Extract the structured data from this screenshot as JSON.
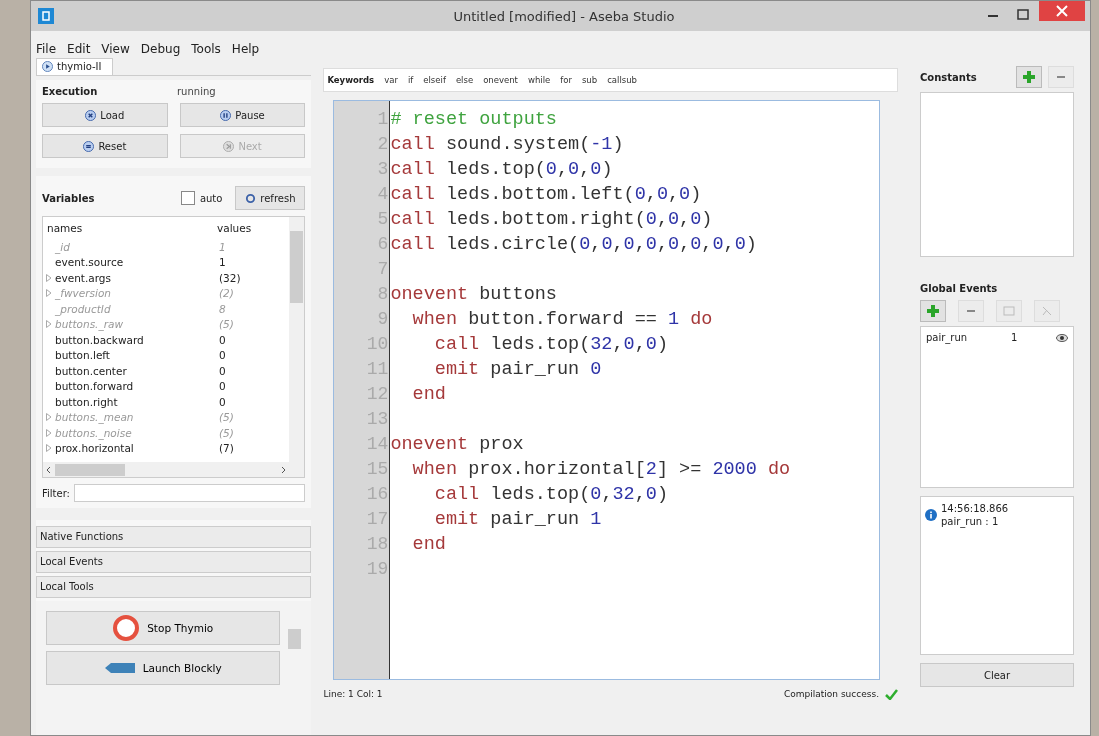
{
  "window": {
    "title": "Untitled [modified] - Aseba Studio"
  },
  "menu": [
    "File",
    "Edit",
    "View",
    "Debug",
    "Tools",
    "Help"
  ],
  "tabs": [
    {
      "label": "thymio-II",
      "selected": true
    }
  ],
  "execution": {
    "title": "Execution",
    "status": "running",
    "buttons": [
      {
        "label": "Load",
        "disabled": false
      },
      {
        "label": "Pause",
        "disabled": false
      },
      {
        "label": "Reset",
        "disabled": false
      },
      {
        "label": "Next",
        "disabled": true
      }
    ]
  },
  "variables": {
    "title": "Variables",
    "auto": {
      "label": "auto",
      "checked": false
    },
    "refresh": "refresh",
    "columns": [
      "names",
      "values"
    ],
    "filter_label": "Filter:",
    "rows": [
      {
        "name": "_id",
        "value": "1",
        "system": true,
        "expandable": false
      },
      {
        "name": "event.source",
        "value": "1",
        "system": false,
        "expandable": false
      },
      {
        "name": "event.args",
        "value": "(32)",
        "system": false,
        "expandable": true
      },
      {
        "name": "_fwversion",
        "value": "(2)",
        "system": true,
        "expandable": true
      },
      {
        "name": "_productId",
        "value": "8",
        "system": true,
        "expandable": false
      },
      {
        "name": "buttons._raw",
        "value": "(5)",
        "system": true,
        "expandable": true
      },
      {
        "name": "button.backward",
        "value": "0",
        "system": false,
        "expandable": false
      },
      {
        "name": "button.left",
        "value": "0",
        "system": false,
        "expandable": false
      },
      {
        "name": "button.center",
        "value": "0",
        "system": false,
        "expandable": false
      },
      {
        "name": "button.forward",
        "value": "0",
        "system": false,
        "expandable": false
      },
      {
        "name": "button.right",
        "value": "0",
        "system": false,
        "expandable": false
      },
      {
        "name": "buttons._mean",
        "value": "(5)",
        "system": true,
        "expandable": true
      },
      {
        "name": "buttons._noise",
        "value": "(5)",
        "system": true,
        "expandable": true
      },
      {
        "name": "prox.horizontal",
        "value": "(7)",
        "system": false,
        "expandable": true
      }
    ]
  },
  "toolbox": {
    "sections": [
      "Native Functions",
      "Local Events",
      "Local Tools"
    ],
    "tools": [
      "Stop Thymio",
      "Launch Blockly"
    ]
  },
  "keywords": {
    "title": "Keywords",
    "items": [
      "var",
      "if",
      "elseif",
      "else",
      "onevent",
      "while",
      "for",
      "sub",
      "callsub"
    ]
  },
  "code": [
    {
      "number": "1",
      "tokens": [
        {
          "kind": "comment",
          "text": "# reset outputs"
        }
      ]
    },
    {
      "number": "2",
      "tokens": [
        {
          "kind": "keyword",
          "text": "call"
        },
        {
          "kind": "plain",
          "text": " sound.system("
        },
        {
          "kind": "number",
          "text": "-1"
        },
        {
          "kind": "plain",
          "text": ")"
        }
      ]
    },
    {
      "number": "3",
      "tokens": [
        {
          "kind": "keyword",
          "text": "call"
        },
        {
          "kind": "plain",
          "text": " leds.top("
        },
        {
          "kind": "number",
          "text": "0"
        },
        {
          "kind": "plain",
          "text": ","
        },
        {
          "kind": "number",
          "text": "0"
        },
        {
          "kind": "plain",
          "text": ","
        },
        {
          "kind": "number",
          "text": "0"
        },
        {
          "kind": "plain",
          "text": ")"
        }
      ]
    },
    {
      "number": "4",
      "tokens": [
        {
          "kind": "keyword",
          "text": "call"
        },
        {
          "kind": "plain",
          "text": " leds.bottom.left("
        },
        {
          "kind": "number",
          "text": "0"
        },
        {
          "kind": "plain",
          "text": ","
        },
        {
          "kind": "number",
          "text": "0"
        },
        {
          "kind": "plain",
          "text": ","
        },
        {
          "kind": "number",
          "text": "0"
        },
        {
          "kind": "plain",
          "text": ")"
        }
      ]
    },
    {
      "number": "5",
      "tokens": [
        {
          "kind": "keyword",
          "text": "call"
        },
        {
          "kind": "plain",
          "text": " leds.bottom.right("
        },
        {
          "kind": "number",
          "text": "0"
        },
        {
          "kind": "plain",
          "text": ","
        },
        {
          "kind": "number",
          "text": "0"
        },
        {
          "kind": "plain",
          "text": ","
        },
        {
          "kind": "number",
          "text": "0"
        },
        {
          "kind": "plain",
          "text": ")"
        }
      ]
    },
    {
      "number": "6",
      "tokens": [
        {
          "kind": "keyword",
          "text": "call"
        },
        {
          "kind": "plain",
          "text": " leds.circle("
        },
        {
          "kind": "number",
          "text": "0"
        },
        {
          "kind": "plain",
          "text": ","
        },
        {
          "kind": "number",
          "text": "0"
        },
        {
          "kind": "plain",
          "text": ","
        },
        {
          "kind": "number",
          "text": "0"
        },
        {
          "kind": "plain",
          "text": ","
        },
        {
          "kind": "number",
          "text": "0"
        },
        {
          "kind": "plain",
          "text": ","
        },
        {
          "kind": "number",
          "text": "0"
        },
        {
          "kind": "plain",
          "text": ","
        },
        {
          "kind": "number",
          "text": "0"
        },
        {
          "kind": "plain",
          "text": ","
        },
        {
          "kind": "number",
          "text": "0"
        },
        {
          "kind": "plain",
          "text": ","
        },
        {
          "kind": "number",
          "text": "0"
        },
        {
          "kind": "plain",
          "text": ")"
        }
      ]
    },
    {
      "number": "7"
    },
    {
      "number": "8",
      "tokens": [
        {
          "kind": "keyword",
          "text": "onevent"
        },
        {
          "kind": "plain",
          "text": " buttons"
        }
      ]
    },
    {
      "number": "9",
      "tokens": [
        {
          "kind": "keyword",
          "text": "  when"
        },
        {
          "kind": "plain",
          "text": " button.forward == "
        },
        {
          "kind": "number",
          "text": "1"
        },
        {
          "kind": "keyword",
          "text": " do"
        }
      ]
    },
    {
      "number": "10",
      "tokens": [
        {
          "kind": "keyword",
          "text": "    call"
        },
        {
          "kind": "plain",
          "text": " leds.top("
        },
        {
          "kind": "number",
          "text": "32"
        },
        {
          "kind": "plain",
          "text": ","
        },
        {
          "kind": "number",
          "text": "0"
        },
        {
          "kind": "plain",
          "text": ","
        },
        {
          "kind": "number",
          "text": "0"
        },
        {
          "kind": "plain",
          "text": ")"
        }
      ]
    },
    {
      "number": "11",
      "tokens": [
        {
          "kind": "keyword",
          "text": "    emit"
        },
        {
          "kind": "plain",
          "text": " pair_run "
        },
        {
          "kind": "number",
          "text": "0"
        }
      ]
    },
    {
      "number": "12",
      "tokens": [
        {
          "kind": "keyword",
          "text": "  end"
        }
      ]
    },
    {
      "number": "13"
    },
    {
      "number": "14",
      "tokens": [
        {
          "kind": "keyword",
          "text": "onevent"
        },
        {
          "kind": "plain",
          "text": " prox"
        }
      ]
    },
    {
      "number": "15",
      "tokens": [
        {
          "kind": "keyword",
          "text": "  when"
        },
        {
          "kind": "plain",
          "text": " prox.horizontal["
        },
        {
          "kind": "number",
          "text": "2"
        },
        {
          "kind": "plain",
          "text": "] >= "
        },
        {
          "kind": "number",
          "text": "2000"
        },
        {
          "kind": "keyword",
          "text": " do"
        }
      ]
    },
    {
      "number": "16",
      "tokens": [
        {
          "kind": "keyword",
          "text": "    call"
        },
        {
          "kind": "plain",
          "text": " leds.top("
        },
        {
          "kind": "number",
          "text": "0"
        },
        {
          "kind": "plain",
          "text": ","
        },
        {
          "kind": "number",
          "text": "32"
        },
        {
          "kind": "plain",
          "text": ","
        },
        {
          "kind": "number",
          "text": "0"
        },
        {
          "kind": "plain",
          "text": ")"
        }
      ]
    },
    {
      "number": "17",
      "tokens": [
        {
          "kind": "keyword",
          "text": "    emit"
        },
        {
          "kind": "plain",
          "text": " pair_run "
        },
        {
          "kind": "number",
          "text": "1"
        }
      ]
    },
    {
      "number": "18",
      "tokens": [
        {
          "kind": "keyword",
          "text": "  end"
        }
      ]
    },
    {
      "number": "19"
    }
  ],
  "status": {
    "position": "Line: 1 Col: 1",
    "message": "Compilation success."
  },
  "constants": {
    "title": "Constants"
  },
  "global_events": {
    "title": "Global Events",
    "events": [
      {
        "name": "pair_run",
        "size": "1"
      }
    ]
  },
  "messages": [
    {
      "time": "14:56:18.866",
      "text": "pair_run : 1"
    }
  ],
  "clear": "Clear"
}
